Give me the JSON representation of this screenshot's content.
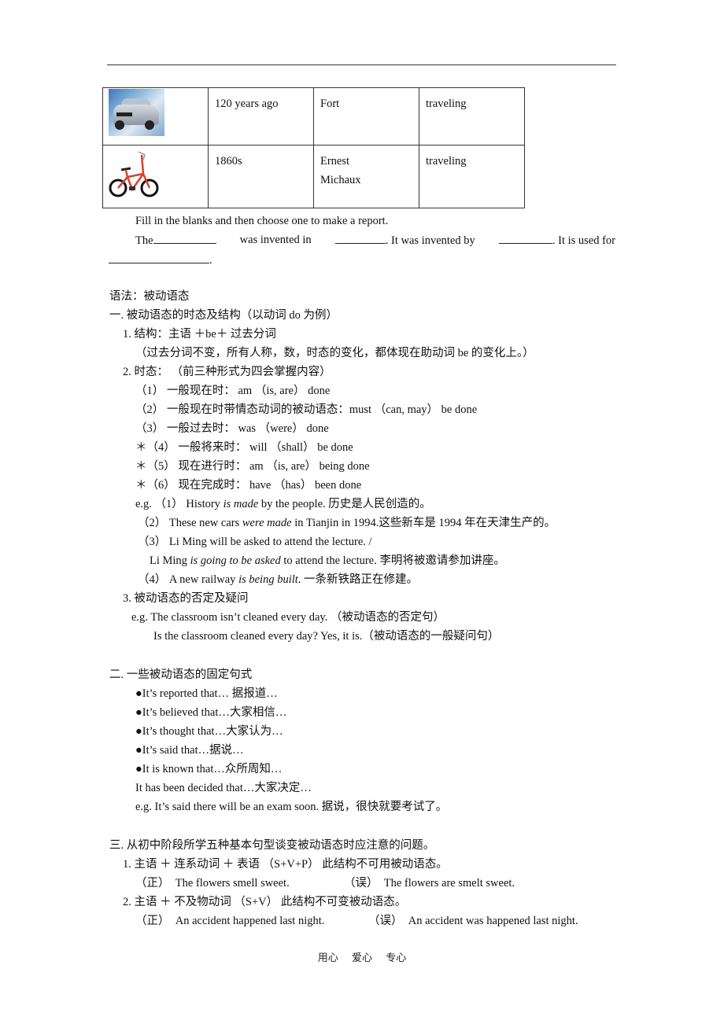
{
  "inventions_table": {
    "rows": [
      {
        "image": "car-image",
        "time": "120 years ago",
        "inventor": "Fort",
        "use": "traveling"
      },
      {
        "image": "bicycle-image",
        "time": "1860s",
        "inventor_line1": "Ernest",
        "inventor_line2": "Michaux",
        "use": "traveling"
      }
    ]
  },
  "exercise": {
    "instruction": "Fill in the blanks and then choose one to make a report.",
    "s_the": "The",
    "s_invented_in": "was invented in",
    "s_invented_by": ". It was invented by",
    "s_used_for": ". It is used for",
    "s_end": "."
  },
  "grammar": {
    "title": "语法：被动语态",
    "sec1": {
      "heading": "一. 被动语态的时态及结构（以动词 do 为例）",
      "p1": "1. 结构：主语 ＋be＋ 过去分词",
      "p1_note": "（过去分词不变，所有人称，数，时态的变化，都体现在助动词 be 的变化上。）",
      "p2": "2. 时态：  （前三种形式为四会掌握内容）",
      "tenses": [
        "（1）  一般现在时：  am  （is, are）  done",
        "（2）  一般现在时带情态动词的被动语态：must  （can, may）  be done",
        "（3）  一般过去时：  was  （were）  done",
        "＊（4）  一般将来时：  will  （shall）  be done",
        "＊（5）  现在进行时：  am  （is, are）  being done",
        "＊（6）  现在完成时：  have  （has）  been done"
      ],
      "ex1_pre": "e.g. （1）  History ",
      "ex1_it": "is made",
      "ex1_post": " by the people.    历史是人民创造的。",
      "ex2_pre": "（2）  These new cars ",
      "ex2_it": "were made",
      "ex2_post": " in Tianjin in 1994.这些新车是 1994 年在天津生产的。",
      "ex3a": "（3）  Li Ming will be asked to attend the lecture. /",
      "ex3b_pre": "Li Ming ",
      "ex3b_it": "is going to be asked",
      "ex3b_post": " to attend the lecture.  李明将被邀请参加讲座。",
      "ex4_pre": "（4）  A new railway ",
      "ex4_it": "is being built",
      "ex4_post": ".  一条新铁路正在修建。",
      "p3": "3. 被动语态的否定及疑问",
      "neg": "e.g. The classroom isn’t cleaned every day.    （被动语态的否定句）",
      "q": "Is the classroom cleaned every day? Yes, it is.（被动语态的一般疑问句）"
    },
    "sec2": {
      "heading": "二. 一些被动语态的固定句式",
      "bullets": [
        "●It’s reported that…    据报道…",
        "●It’s believed that…大家相信…",
        "●It’s thought that…大家认为…",
        "●It’s said that…据说…",
        "●It is known that…众所周知…"
      ],
      "decided": "It has been decided that…大家决定…",
      "example": "e.g. It’s said there will be an exam soon.  据说，很快就要考试了。"
    },
    "sec3": {
      "heading": "三. 从初中阶段所学五种基本句型谈变被动语态时应注意的问题。",
      "p1": "1. 主语 ＋ 连系动词 ＋ 表语 （S+V+P）      此结构不可用被动语态。",
      "p1_right_label": "（正）",
      "p1_right": "The flowers smell sweet.",
      "p1_wrong_label": "（误）",
      "p1_wrong": "The flowers are smelt sweet.",
      "p2": "2. 主语 ＋ 不及物动词 （S+V）       此结构不可变被动语态。",
      "p2_right_label": "（正）",
      "p2_right": "An accident happened last night.",
      "p2_wrong_label": "（误）",
      "p2_wrong": "An accident was happened last night."
    }
  },
  "footer": {
    "items": [
      "用心",
      "爱心",
      "专心"
    ]
  }
}
